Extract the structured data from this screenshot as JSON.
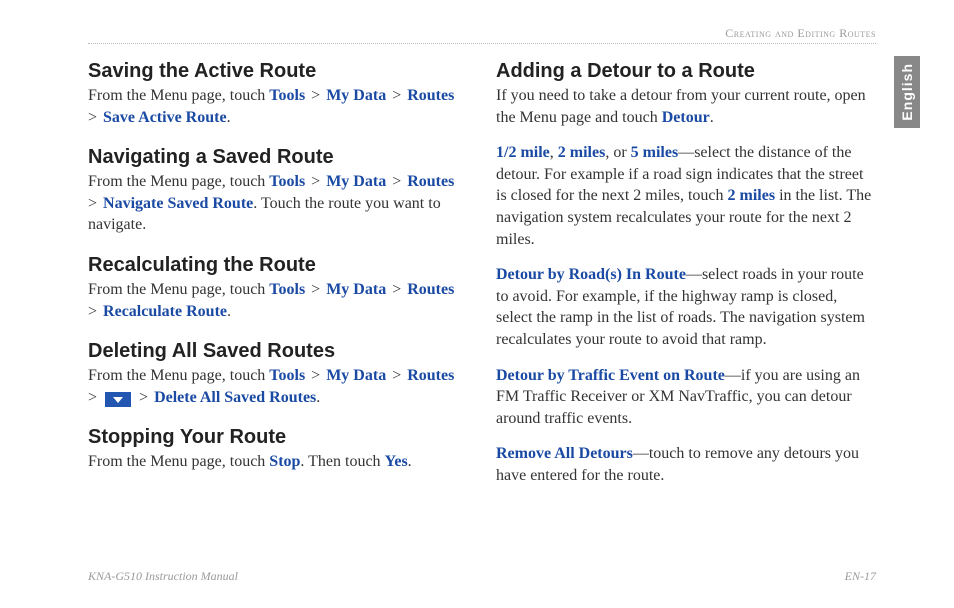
{
  "chapter": "Creating and Editing Routes",
  "langTab": "English",
  "left": {
    "s1": {
      "title": "Saving the Active Route",
      "lead": "From the Menu page, touch ",
      "tools": "Tools",
      "mydata": "My Data",
      "routes": "Routes",
      "action": "Save Active Route",
      "end": "."
    },
    "s2": {
      "title": "Navigating a Saved Route",
      "lead": "From the Menu page, touch ",
      "tools": "Tools",
      "mydata": "My Data",
      "routes": "Routes",
      "action": "Navigate Saved Route",
      "tail": ". Touch the route you want to navigate."
    },
    "s3": {
      "title": "Recalculating the Route",
      "lead": "From the Menu page, touch ",
      "tools": "Tools",
      "mydata": "My Data",
      "routes": "Routes",
      "action": "Recalculate Route",
      "end": "."
    },
    "s4": {
      "title": "Deleting All Saved Routes",
      "lead": "From the Menu page, touch ",
      "tools": "Tools",
      "mydata": "My Data",
      "routes": "Routes",
      "action": "Delete All Saved Routes",
      "end": "."
    },
    "s5": {
      "title": "Stopping Your Route",
      "lead": "From the Menu page, touch ",
      "stop": "Stop",
      "mid": ". Then touch ",
      "yes": "Yes",
      "end": "."
    }
  },
  "right": {
    "title": "Adding a Detour to a Route",
    "p1a": "If you need to take a detour from your current route, open the Menu page and touch ",
    "detour": "Detour",
    "p1b": ".",
    "p2": {
      "half": "1/2 mile",
      "c1": ", ",
      "two_a": "2 miles",
      "c2": ", or ",
      "five": "5 miles",
      "t1": "—select the distance of the detour. For example if a road sign indicates that the street is closed for the next 2 miles, touch ",
      "two_b": "2 miles",
      "t2": " in the list. The navigation system recalculates your route for the next 2 miles."
    },
    "p3": {
      "h": "Detour by Road(s) In Route",
      "t": "—select roads in your route to avoid. For example, if the highway ramp is closed, select the ramp in the list of roads. The navigation system recalculates your route to avoid that ramp."
    },
    "p4": {
      "h": "Detour by Traffic Event on Route",
      "t": "—if you are using an FM Traffic Receiver or XM NavTraffic, you can detour around traffic events."
    },
    "p5": {
      "h": "Remove All Detours",
      "t": "—touch to remove any detours you have entered for the route."
    }
  },
  "footer": {
    "manual": "KNA-G510 Instruction Manual",
    "page": "EN-17"
  }
}
